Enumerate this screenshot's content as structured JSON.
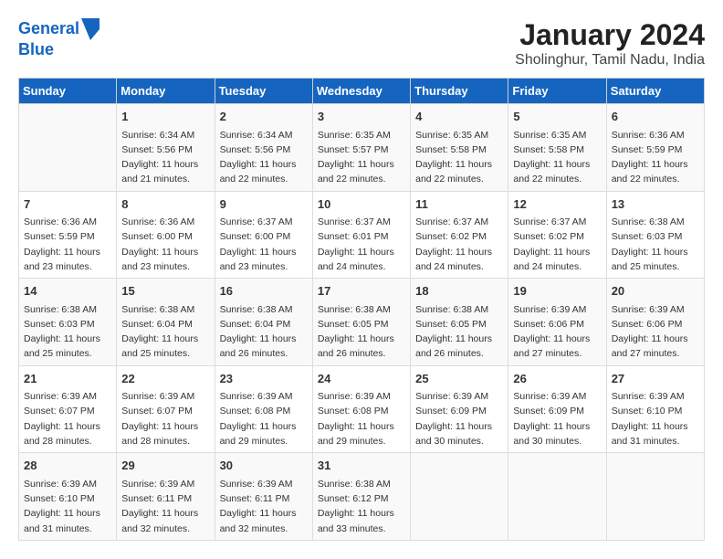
{
  "logo": {
    "line1": "General",
    "line2": "Blue"
  },
  "title": "January 2024",
  "subtitle": "Sholinghur, Tamil Nadu, India",
  "headers": [
    "Sunday",
    "Monday",
    "Tuesday",
    "Wednesday",
    "Thursday",
    "Friday",
    "Saturday"
  ],
  "weeks": [
    [
      {
        "day": "",
        "info": ""
      },
      {
        "day": "1",
        "info": "Sunrise: 6:34 AM\nSunset: 5:56 PM\nDaylight: 11 hours\nand 21 minutes."
      },
      {
        "day": "2",
        "info": "Sunrise: 6:34 AM\nSunset: 5:56 PM\nDaylight: 11 hours\nand 22 minutes."
      },
      {
        "day": "3",
        "info": "Sunrise: 6:35 AM\nSunset: 5:57 PM\nDaylight: 11 hours\nand 22 minutes."
      },
      {
        "day": "4",
        "info": "Sunrise: 6:35 AM\nSunset: 5:58 PM\nDaylight: 11 hours\nand 22 minutes."
      },
      {
        "day": "5",
        "info": "Sunrise: 6:35 AM\nSunset: 5:58 PM\nDaylight: 11 hours\nand 22 minutes."
      },
      {
        "day": "6",
        "info": "Sunrise: 6:36 AM\nSunset: 5:59 PM\nDaylight: 11 hours\nand 22 minutes."
      }
    ],
    [
      {
        "day": "7",
        "info": "Sunrise: 6:36 AM\nSunset: 5:59 PM\nDaylight: 11 hours\nand 23 minutes."
      },
      {
        "day": "8",
        "info": "Sunrise: 6:36 AM\nSunset: 6:00 PM\nDaylight: 11 hours\nand 23 minutes."
      },
      {
        "day": "9",
        "info": "Sunrise: 6:37 AM\nSunset: 6:00 PM\nDaylight: 11 hours\nand 23 minutes."
      },
      {
        "day": "10",
        "info": "Sunrise: 6:37 AM\nSunset: 6:01 PM\nDaylight: 11 hours\nand 24 minutes."
      },
      {
        "day": "11",
        "info": "Sunrise: 6:37 AM\nSunset: 6:02 PM\nDaylight: 11 hours\nand 24 minutes."
      },
      {
        "day": "12",
        "info": "Sunrise: 6:37 AM\nSunset: 6:02 PM\nDaylight: 11 hours\nand 24 minutes."
      },
      {
        "day": "13",
        "info": "Sunrise: 6:38 AM\nSunset: 6:03 PM\nDaylight: 11 hours\nand 25 minutes."
      }
    ],
    [
      {
        "day": "14",
        "info": "Sunrise: 6:38 AM\nSunset: 6:03 PM\nDaylight: 11 hours\nand 25 minutes."
      },
      {
        "day": "15",
        "info": "Sunrise: 6:38 AM\nSunset: 6:04 PM\nDaylight: 11 hours\nand 25 minutes."
      },
      {
        "day": "16",
        "info": "Sunrise: 6:38 AM\nSunset: 6:04 PM\nDaylight: 11 hours\nand 26 minutes."
      },
      {
        "day": "17",
        "info": "Sunrise: 6:38 AM\nSunset: 6:05 PM\nDaylight: 11 hours\nand 26 minutes."
      },
      {
        "day": "18",
        "info": "Sunrise: 6:38 AM\nSunset: 6:05 PM\nDaylight: 11 hours\nand 26 minutes."
      },
      {
        "day": "19",
        "info": "Sunrise: 6:39 AM\nSunset: 6:06 PM\nDaylight: 11 hours\nand 27 minutes."
      },
      {
        "day": "20",
        "info": "Sunrise: 6:39 AM\nSunset: 6:06 PM\nDaylight: 11 hours\nand 27 minutes."
      }
    ],
    [
      {
        "day": "21",
        "info": "Sunrise: 6:39 AM\nSunset: 6:07 PM\nDaylight: 11 hours\nand 28 minutes."
      },
      {
        "day": "22",
        "info": "Sunrise: 6:39 AM\nSunset: 6:07 PM\nDaylight: 11 hours\nand 28 minutes."
      },
      {
        "day": "23",
        "info": "Sunrise: 6:39 AM\nSunset: 6:08 PM\nDaylight: 11 hours\nand 29 minutes."
      },
      {
        "day": "24",
        "info": "Sunrise: 6:39 AM\nSunset: 6:08 PM\nDaylight: 11 hours\nand 29 minutes."
      },
      {
        "day": "25",
        "info": "Sunrise: 6:39 AM\nSunset: 6:09 PM\nDaylight: 11 hours\nand 30 minutes."
      },
      {
        "day": "26",
        "info": "Sunrise: 6:39 AM\nSunset: 6:09 PM\nDaylight: 11 hours\nand 30 minutes."
      },
      {
        "day": "27",
        "info": "Sunrise: 6:39 AM\nSunset: 6:10 PM\nDaylight: 11 hours\nand 31 minutes."
      }
    ],
    [
      {
        "day": "28",
        "info": "Sunrise: 6:39 AM\nSunset: 6:10 PM\nDaylight: 11 hours\nand 31 minutes."
      },
      {
        "day": "29",
        "info": "Sunrise: 6:39 AM\nSunset: 6:11 PM\nDaylight: 11 hours\nand 32 minutes."
      },
      {
        "day": "30",
        "info": "Sunrise: 6:39 AM\nSunset: 6:11 PM\nDaylight: 11 hours\nand 32 minutes."
      },
      {
        "day": "31",
        "info": "Sunrise: 6:38 AM\nSunset: 6:12 PM\nDaylight: 11 hours\nand 33 minutes."
      },
      {
        "day": "",
        "info": ""
      },
      {
        "day": "",
        "info": ""
      },
      {
        "day": "",
        "info": ""
      }
    ]
  ]
}
